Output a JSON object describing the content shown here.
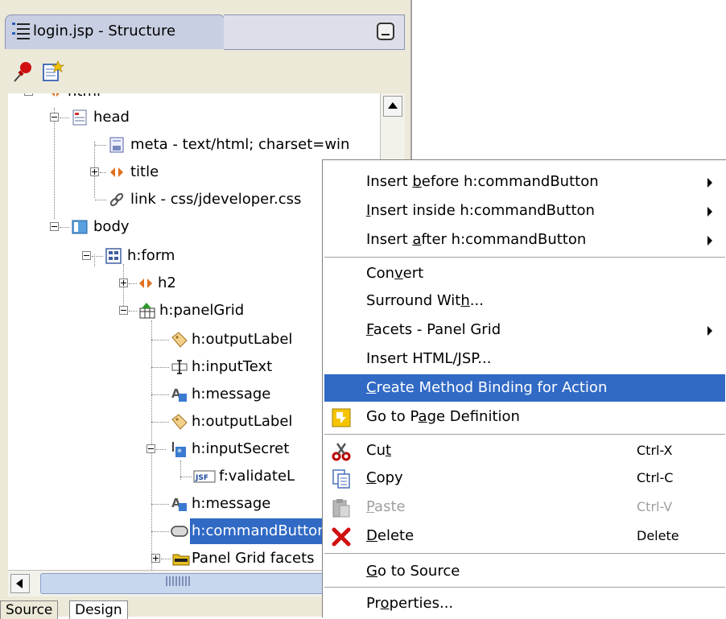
{
  "panel": {
    "title": "login.jsp - Structure",
    "bottom_tabs": [
      "Source",
      "Design"
    ]
  },
  "tree": {
    "rows": [
      {
        "label": "html"
      },
      {
        "label": "head"
      },
      {
        "label": "meta - text/html; charset=win"
      },
      {
        "label": "title"
      },
      {
        "label": "link - css/jdeveloper.css"
      },
      {
        "label": "body"
      },
      {
        "label": "h:form"
      },
      {
        "label": "h2"
      },
      {
        "label": "h:panelGrid"
      },
      {
        "label": "h:outputLabel"
      },
      {
        "label": "h:inputText"
      },
      {
        "label": "h:message"
      },
      {
        "label": "h:outputLabel"
      },
      {
        "label": "h:inputSecret"
      },
      {
        "label": "f:validateL"
      },
      {
        "label": "h:message"
      },
      {
        "label": "h:commandButton"
      },
      {
        "label": "Panel Grid facets"
      }
    ]
  },
  "menu": {
    "items": [
      {
        "pre": "Insert ",
        "key": "b",
        "post": "efore h:commandButton",
        "submenu": true
      },
      {
        "pre": "",
        "key": "I",
        "post": "nsert inside h:commandButton",
        "submenu": true
      },
      {
        "pre": "Insert ",
        "key": "a",
        "post": "fter h:commandButton",
        "submenu": true
      },
      {
        "pre": "Con",
        "key": "v",
        "post": "ert"
      },
      {
        "pre": "Surround Wit",
        "key": "h",
        "post": "..."
      },
      {
        "pre": "",
        "key": "F",
        "post": "acets - Panel Grid",
        "submenu": true
      },
      {
        "pre": "Insert HTML/",
        "key": "J",
        "post": "SP..."
      },
      {
        "pre": "",
        "key": "C",
        "post": "reate Method Binding for Action",
        "highlighted": true
      },
      {
        "pre": "Go to P",
        "key": "a",
        "post": "ge Definition",
        "icon": "page-definition-icon"
      },
      {
        "pre": "Cu",
        "key": "t",
        "post": "",
        "shortcut": "Ctrl-X",
        "icon": "scissors-icon"
      },
      {
        "pre": "",
        "key": "C",
        "post": "opy",
        "shortcut": "Ctrl-C",
        "icon": "copy-icon"
      },
      {
        "pre": "",
        "key": "P",
        "post": "aste",
        "shortcut": "Ctrl-V",
        "icon": "paste-icon",
        "disabled": true
      },
      {
        "pre": "",
        "key": "D",
        "post": "elete",
        "shortcut": "Delete",
        "icon": "delete-x-icon"
      },
      {
        "pre": "",
        "key": "G",
        "post": "o to Source"
      },
      {
        "pre": "Pr",
        "key": "o",
        "post": "perties..."
      }
    ]
  },
  "colors": {
    "selection": "#316ac5",
    "panel_bg": "#ece9d8"
  }
}
